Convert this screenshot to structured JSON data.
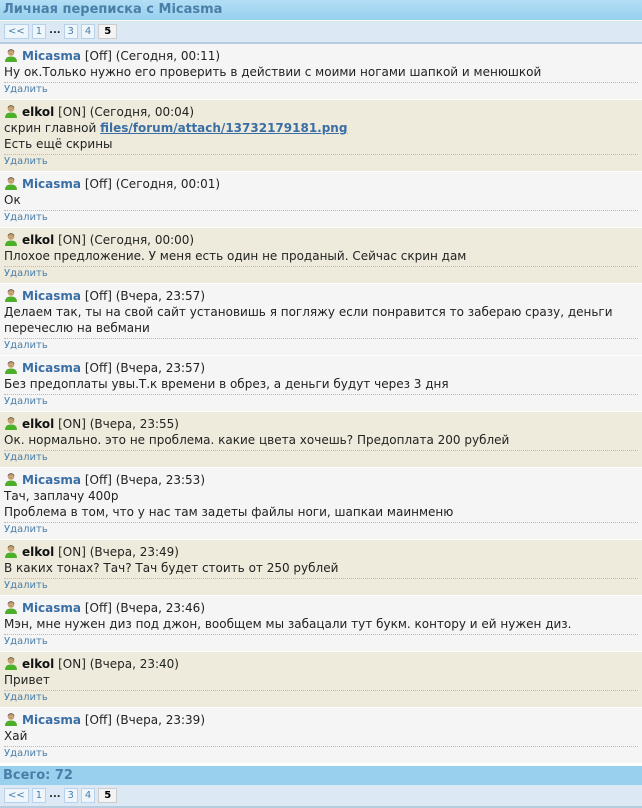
{
  "title": "Личная переписка с Micasma",
  "pager": {
    "prev": "<<",
    "pages": [
      "1",
      "...",
      "3",
      "4",
      "5"
    ],
    "current": "5"
  },
  "delete_label": "Удалить",
  "messages": [
    {
      "user": "Micasma",
      "status": "[Off]",
      "time": "(Сегодня, 00:11)",
      "online": false,
      "lines": [
        "Ну ок.Только нужно его проверить в действии с моими ногами шапкой и менюшкой"
      ]
    },
    {
      "user": "elkol",
      "status": "[ON]",
      "time": "(Сегодня, 00:04)",
      "online": true,
      "lines": [
        "скрин главной ",
        "Есть ещё скрины"
      ],
      "link": "files/forum/attach/13732179181.png"
    },
    {
      "user": "Micasma",
      "status": "[Off]",
      "time": "(Сегодня, 00:01)",
      "online": false,
      "lines": [
        "Ок"
      ]
    },
    {
      "user": "elkol",
      "status": "[ON]",
      "time": "(Сегодня, 00:00)",
      "online": true,
      "lines": [
        "Плохое предложение. У меня есть один не проданый. Сейчас скрин дам"
      ]
    },
    {
      "user": "Micasma",
      "status": "[Off]",
      "time": "(Вчера, 23:57)",
      "online": false,
      "lines": [
        "Делаем так, ты на свой сайт установишь я погляжу если понравится то забераю сразу, деньги перечеслю на вебмани"
      ]
    },
    {
      "user": "Micasma",
      "status": "[Off]",
      "time": "(Вчера, 23:57)",
      "online": false,
      "lines": [
        "Без предоплаты увы.Т.к времени в обрез, а деньги будут через 3 дня"
      ]
    },
    {
      "user": "elkol",
      "status": "[ON]",
      "time": "(Вчера, 23:55)",
      "online": true,
      "lines": [
        "Ок. нормально. это не проблема. какие цвета хочешь? Предоплата 200 рублей"
      ]
    },
    {
      "user": "Micasma",
      "status": "[Off]",
      "time": "(Вчера, 23:53)",
      "online": false,
      "lines": [
        "Тач, заплачу 400р",
        "Проблема в том, что у нас там задеты файлы ноги, шапкаи маинменю"
      ]
    },
    {
      "user": "elkol",
      "status": "[ON]",
      "time": "(Вчера, 23:49)",
      "online": true,
      "lines": [
        "В каких тонах? Тач? Тач будет стоить от 250 рублей"
      ]
    },
    {
      "user": "Micasma",
      "status": "[Off]",
      "time": "(Вчера, 23:46)",
      "online": false,
      "lines": [
        "Мэн, мне нужен диз под джон, вообщем мы забацали тут букм. контору и ей нужен диз."
      ]
    },
    {
      "user": "elkol",
      "status": "[ON]",
      "time": "(Вчера, 23:40)",
      "online": true,
      "lines": [
        "Привет"
      ]
    },
    {
      "user": "Micasma",
      "status": "[Off]",
      "time": "(Вчера, 23:39)",
      "online": false,
      "lines": [
        "Хай"
      ]
    }
  ],
  "total": "Всего: 72"
}
